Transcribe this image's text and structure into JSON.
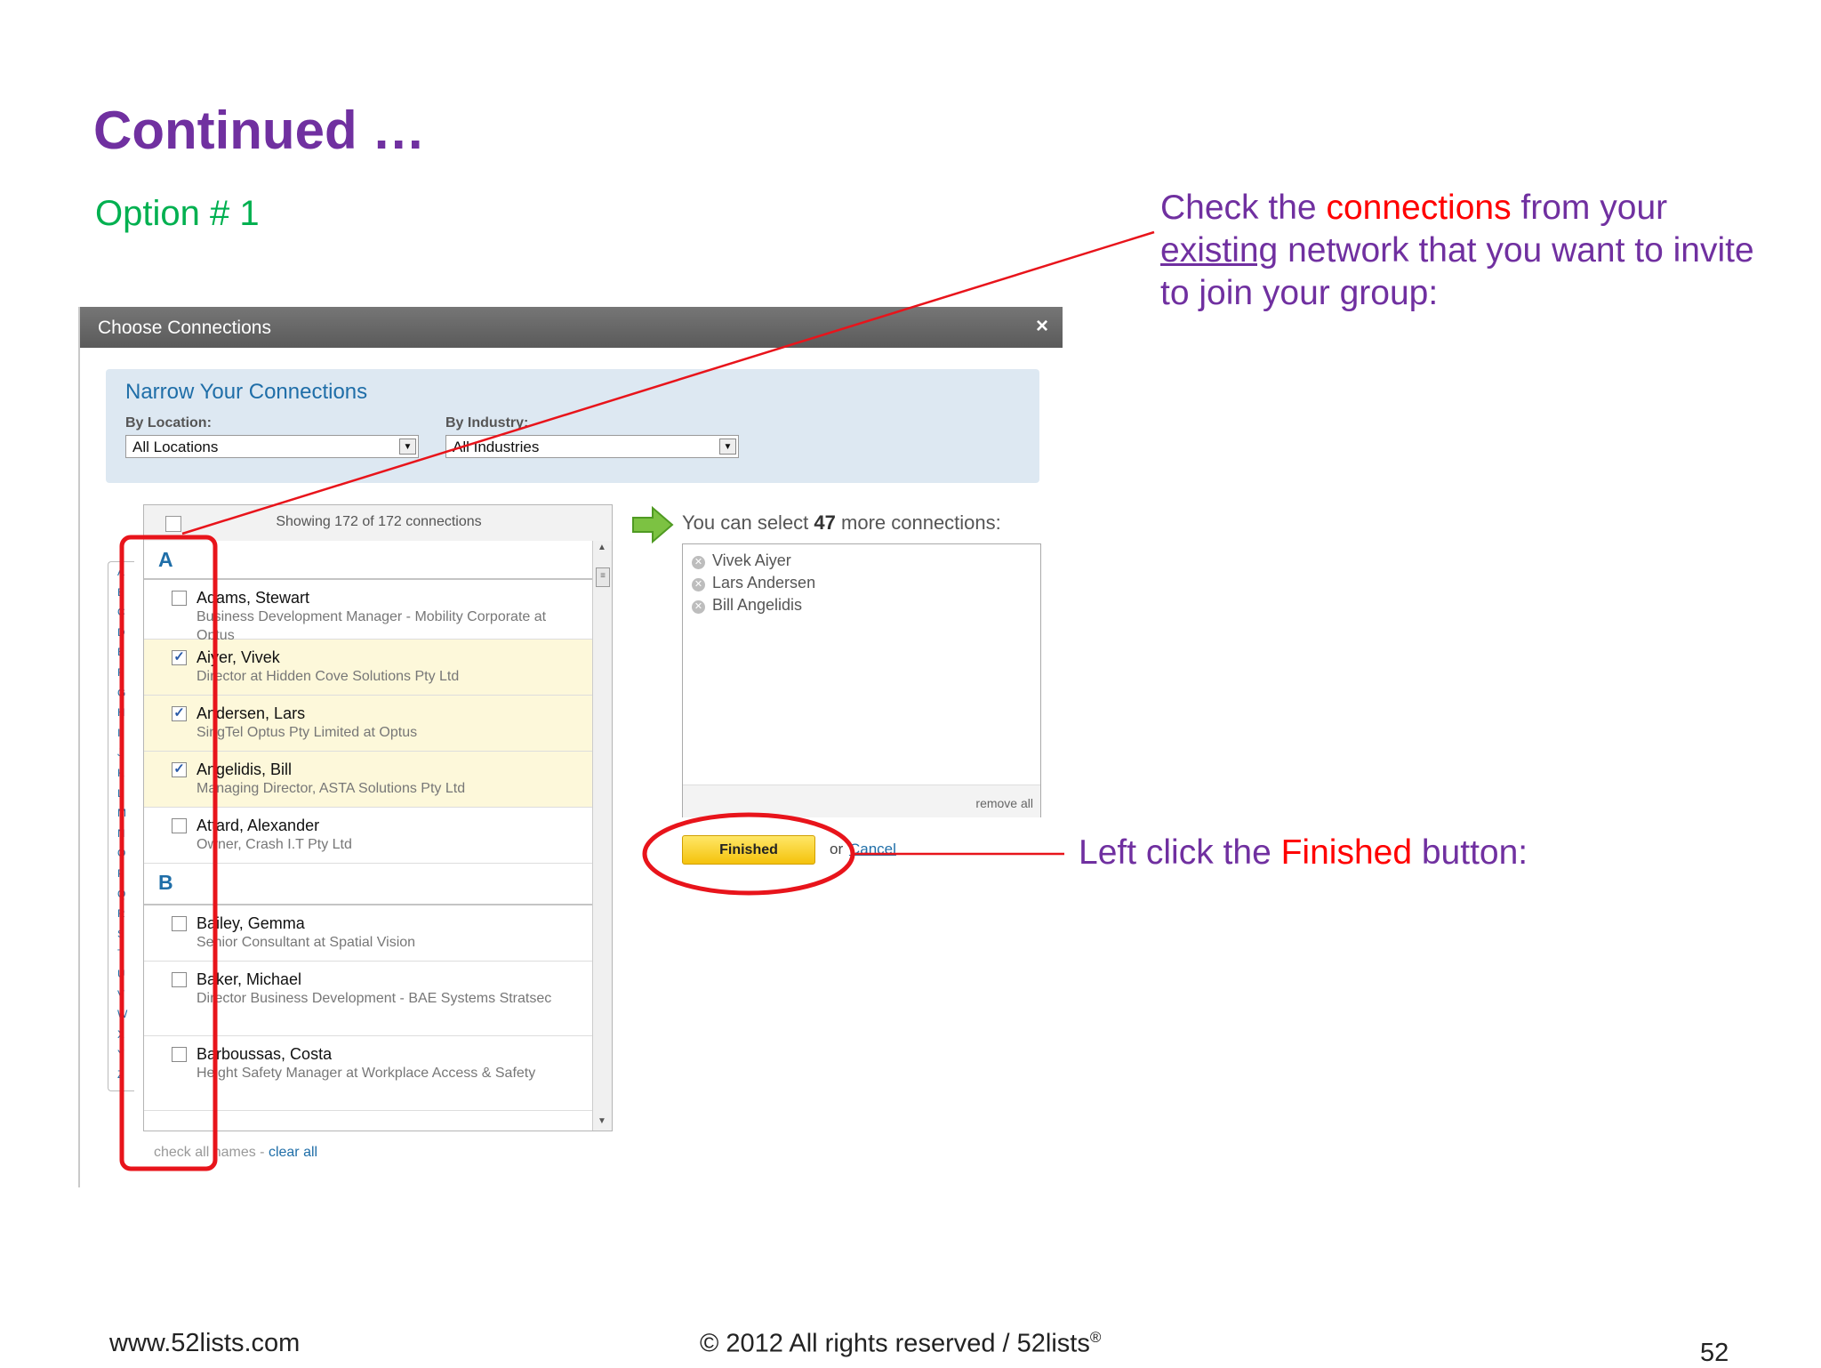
{
  "slide": {
    "title": "Continued …",
    "option": "Option # 1",
    "callout1": {
      "part1": "Check the ",
      "highlight": "connections",
      "part2": " from your ",
      "underlined": "existing",
      "part3": " network that you want to invite to join your group:"
    },
    "callout2": {
      "part1": "Left click the ",
      "highlight": "Finished",
      "part2": " button:"
    },
    "footer_left": "www.52lists.com",
    "footer_mid": "© 2012 All rights reserved / 52lists",
    "footer_reg": "®",
    "page_number": "52",
    "annotation_color": "#e8141b"
  },
  "dialog": {
    "title": "Choose Connections",
    "close_glyph": "×",
    "narrow": {
      "heading": "Narrow Your Connections",
      "location_label": "By Location:",
      "location_value": "All Locations",
      "industry_label": "By Industry:",
      "industry_value": "All Industries"
    },
    "list": {
      "showing": "Showing 172 of 172 connections",
      "alphabet": [
        "A",
        "B",
        "C",
        "D",
        "E",
        "F",
        "G",
        "H",
        "I",
        "J",
        "K",
        "L",
        "M",
        "N",
        "O",
        "P",
        "Q",
        "R",
        "S",
        "T",
        "U",
        "V",
        "W",
        "X",
        "Y",
        "Z"
      ],
      "group_a": "A",
      "group_b": "B",
      "rows": [
        {
          "name": "Adams, Stewart",
          "sub": "Business Development Manager - Mobility Corporate at Optus",
          "checked": false
        },
        {
          "name": "Aiyer, Vivek",
          "sub": "Director at Hidden Cove Solutions Pty Ltd",
          "checked": true
        },
        {
          "name": "Andersen, Lars",
          "sub": "SingTel Optus Pty Limited at Optus",
          "checked": true
        },
        {
          "name": "Angelidis, Bill",
          "sub": "Managing Director, ASTA Solutions Pty Ltd",
          "checked": true
        },
        {
          "name": "Attard, Alexander",
          "sub": "Owner, Crash I.T Pty Ltd",
          "checked": false
        },
        {
          "name": "Bailey, Gemma",
          "sub": "Senior Consultant at Spatial Vision",
          "checked": false
        },
        {
          "name": "Baker, Michael",
          "sub": "Director Business Development - BAE Systems Stratsec",
          "checked": false
        },
        {
          "name": "Barboussas, Costa",
          "sub": "Height Safety Manager at Workplace Access & Safety",
          "checked": false
        }
      ],
      "footer_check": "check all names",
      "footer_sep": " - ",
      "footer_clear": "clear all"
    },
    "selected": {
      "prefix": "You can select ",
      "count": "47",
      "suffix": " more connections:",
      "items": [
        "Vivek Aiyer",
        "Lars Andersen",
        "Bill Angelidis"
      ],
      "remove_all": "remove all"
    },
    "finished_label": "Finished",
    "or_text": "or",
    "cancel_label": "Cancel"
  }
}
